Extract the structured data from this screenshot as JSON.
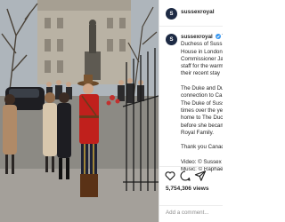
{
  "account": {
    "username": "sussexroyal",
    "avatar_initial": "S"
  },
  "caption": {
    "username": "sussexroyal",
    "lines": [
      "Duchess of Suss",
      "House in London",
      "Commissioner Ja",
      "staff for the warm",
      "their recent stay",
      "The Duke and Du",
      "connection to Ca",
      "The Duke of Suss",
      "times over the ye",
      "home to The Duc",
      "before she becam",
      "Royal Family.",
      "Thank you Canad",
      "Video: © Sussex",
      "Music: © Raphae"
    ]
  },
  "stats": {
    "views": "5,754,306 views"
  },
  "comment": {
    "placeholder": "Add a comment..."
  },
  "icons": {
    "like": "heart-icon",
    "comment": "comment-icon",
    "share": "share-icon",
    "verified": "verified-badge-icon"
  },
  "colors": {
    "brand_avatar": "#1d2a44",
    "link": "#00376b",
    "text": "#262626",
    "muted": "#8e8e8e"
  }
}
